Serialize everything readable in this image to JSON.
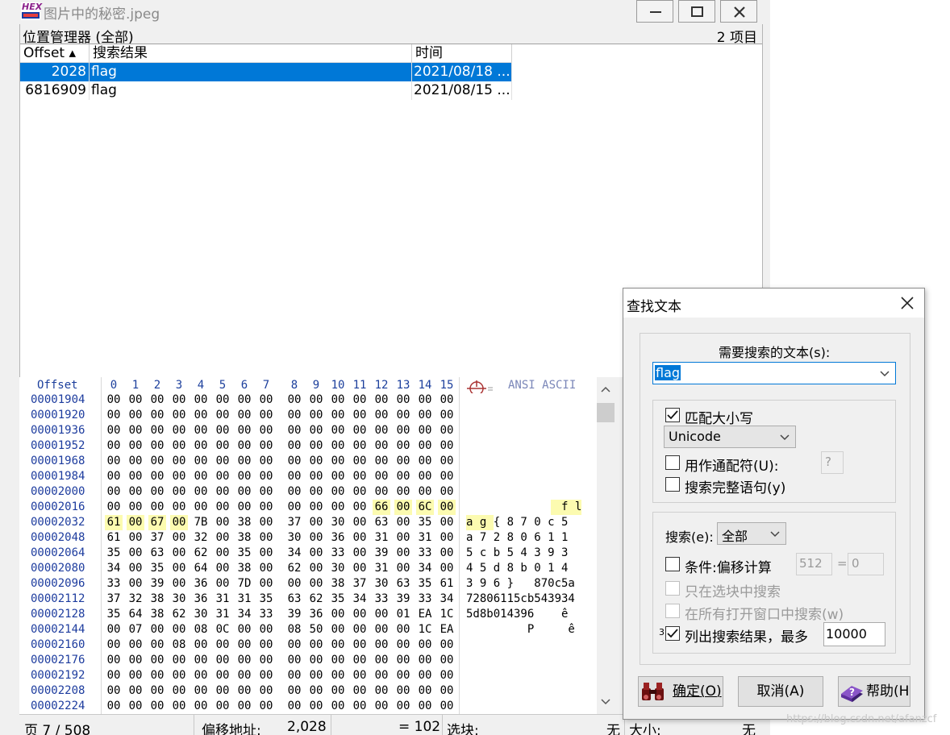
{
  "window": {
    "title": "图片中的秘密.jpeg",
    "logo_text": "HEX"
  },
  "position_manager": {
    "title": "位置管理器 (全部)",
    "count": "2 项目",
    "columns": [
      "Offset ▴",
      "搜索结果",
      "时间"
    ],
    "rows": [
      {
        "offset": "2028",
        "result": "flag",
        "time": "2021/08/18 ...",
        "selected": true
      },
      {
        "offset": "6816909",
        "result": "flag",
        "time": "2021/08/15 ...",
        "selected": false
      }
    ]
  },
  "hex_editor": {
    "offset_header": "Offset",
    "columns": [
      "0",
      "1",
      "2",
      "3",
      "4",
      "5",
      "6",
      "7",
      "8",
      "9",
      "10",
      "11",
      "12",
      "13",
      "14",
      "15"
    ],
    "ansi_header": "ANSI ASCII",
    "rows": [
      {
        "offset": "00001904",
        "bytes": [
          "00",
          "00",
          "00",
          "00",
          "00",
          "00",
          "00",
          "00",
          "00",
          "00",
          "00",
          "00",
          "00",
          "00",
          "00",
          "00"
        ],
        "ascii": ""
      },
      {
        "offset": "00001920",
        "bytes": [
          "00",
          "00",
          "00",
          "00",
          "00",
          "00",
          "00",
          "00",
          "00",
          "00",
          "00",
          "00",
          "00",
          "00",
          "00",
          "00"
        ],
        "ascii": ""
      },
      {
        "offset": "00001936",
        "bytes": [
          "00",
          "00",
          "00",
          "00",
          "00",
          "00",
          "00",
          "00",
          "00",
          "00",
          "00",
          "00",
          "00",
          "00",
          "00",
          "00"
        ],
        "ascii": ""
      },
      {
        "offset": "00001952",
        "bytes": [
          "00",
          "00",
          "00",
          "00",
          "00",
          "00",
          "00",
          "00",
          "00",
          "00",
          "00",
          "00",
          "00",
          "00",
          "00",
          "00"
        ],
        "ascii": ""
      },
      {
        "offset": "00001968",
        "bytes": [
          "00",
          "00",
          "00",
          "00",
          "00",
          "00",
          "00",
          "00",
          "00",
          "00",
          "00",
          "00",
          "00",
          "00",
          "00",
          "00"
        ],
        "ascii": ""
      },
      {
        "offset": "00001984",
        "bytes": [
          "00",
          "00",
          "00",
          "00",
          "00",
          "00",
          "00",
          "00",
          "00",
          "00",
          "00",
          "00",
          "00",
          "00",
          "00",
          "00"
        ],
        "ascii": ""
      },
      {
        "offset": "00002000",
        "bytes": [
          "00",
          "00",
          "00",
          "00",
          "00",
          "00",
          "00",
          "00",
          "00",
          "00",
          "00",
          "00",
          "00",
          "00",
          "00",
          "00"
        ],
        "ascii": ""
      },
      {
        "offset": "00002016",
        "bytes": [
          "00",
          "00",
          "00",
          "00",
          "00",
          "00",
          "00",
          "00",
          "00",
          "00",
          "00",
          "00",
          "66",
          "00",
          "6C",
          "00"
        ],
        "ascii": "              f l"
      },
      {
        "offset": "00002032",
        "bytes": [
          "61",
          "00",
          "67",
          "00",
          "7B",
          "00",
          "38",
          "00",
          "37",
          "00",
          "30",
          "00",
          "63",
          "00",
          "35",
          "00"
        ],
        "ascii": "a g { 8 7 0 c 5 "
      },
      {
        "offset": "00002048",
        "bytes": [
          "61",
          "00",
          "37",
          "00",
          "32",
          "00",
          "38",
          "00",
          "30",
          "00",
          "36",
          "00",
          "31",
          "00",
          "31",
          "00"
        ],
        "ascii": "a 7 2 8 0 6 1 1 "
      },
      {
        "offset": "00002064",
        "bytes": [
          "35",
          "00",
          "63",
          "00",
          "62",
          "00",
          "35",
          "00",
          "34",
          "00",
          "33",
          "00",
          "39",
          "00",
          "33",
          "00"
        ],
        "ascii": "5 c b 5 4 3 9 3 "
      },
      {
        "offset": "00002080",
        "bytes": [
          "34",
          "00",
          "35",
          "00",
          "64",
          "00",
          "38",
          "00",
          "62",
          "00",
          "30",
          "00",
          "31",
          "00",
          "34",
          "00"
        ],
        "ascii": "4 5 d 8 b 0 1 4 "
      },
      {
        "offset": "00002096",
        "bytes": [
          "33",
          "00",
          "39",
          "00",
          "36",
          "00",
          "7D",
          "00",
          "00",
          "00",
          "38",
          "37",
          "30",
          "63",
          "35",
          "61"
        ],
        "ascii": "3 9 6 }   870c5a"
      },
      {
        "offset": "00002112",
        "bytes": [
          "37",
          "32",
          "38",
          "30",
          "36",
          "31",
          "31",
          "35",
          "63",
          "62",
          "35",
          "34",
          "33",
          "39",
          "33",
          "34"
        ],
        "ascii": "72806115cb543934"
      },
      {
        "offset": "00002128",
        "bytes": [
          "35",
          "64",
          "38",
          "62",
          "30",
          "31",
          "34",
          "33",
          "39",
          "36",
          "00",
          "00",
          "00",
          "01",
          "EA",
          "1C"
        ],
        "ascii": "5d8b014396    ê "
      },
      {
        "offset": "00002144",
        "bytes": [
          "00",
          "07",
          "00",
          "00",
          "08",
          "0C",
          "00",
          "00",
          "08",
          "50",
          "00",
          "00",
          "00",
          "00",
          "1C",
          "EA"
        ],
        "ascii": "         P     ê"
      },
      {
        "offset": "00002160",
        "bytes": [
          "00",
          "00",
          "00",
          "08",
          "00",
          "00",
          "00",
          "00",
          "00",
          "00",
          "00",
          "00",
          "00",
          "00",
          "00",
          "00"
        ],
        "ascii": ""
      },
      {
        "offset": "00002176",
        "bytes": [
          "00",
          "00",
          "00",
          "00",
          "00",
          "00",
          "00",
          "00",
          "00",
          "00",
          "00",
          "00",
          "00",
          "00",
          "00",
          "00"
        ],
        "ascii": ""
      },
      {
        "offset": "00002192",
        "bytes": [
          "00",
          "00",
          "00",
          "00",
          "00",
          "00",
          "00",
          "00",
          "00",
          "00",
          "00",
          "00",
          "00",
          "00",
          "00",
          "00"
        ],
        "ascii": ""
      },
      {
        "offset": "00002208",
        "bytes": [
          "00",
          "00",
          "00",
          "00",
          "00",
          "00",
          "00",
          "00",
          "00",
          "00",
          "00",
          "00",
          "00",
          "00",
          "00",
          "00"
        ],
        "ascii": ""
      },
      {
        "offset": "00002224",
        "bytes": [
          "00",
          "00",
          "00",
          "00",
          "00",
          "00",
          "00",
          "00",
          "00",
          "00",
          "00",
          "00",
          "00",
          "00",
          "00",
          "00"
        ],
        "ascii": ""
      }
    ],
    "highlight_color": "#fcfbb0",
    "offset_color": "#1d3c9e"
  },
  "statusbar": {
    "page": "页 7 / 508",
    "offset_label": "偏移地址:",
    "offset_value": "2,028",
    "value": "= 102",
    "block_label": "选块:",
    "block_value": "无",
    "size_label": "大小:",
    "size_value": "无"
  },
  "find_dialog": {
    "title": "查找文本",
    "search_label": "需要搜索的文本(s):",
    "search_value": "flag",
    "match_case": {
      "label": "匹配大小写",
      "checked": true
    },
    "encoding": "Unicode",
    "wildcard": {
      "label": "用作通配符(U):",
      "checked": false,
      "value": "?"
    },
    "whole_word": {
      "label": "搜索完整语句(y)",
      "checked": false
    },
    "search_scope_label": "搜索(e):",
    "search_scope_value": "全部",
    "condition": {
      "label": "条件:偏移计算",
      "checked": false,
      "value1": "512",
      "eq": "=",
      "value2": "0"
    },
    "in_block": {
      "label": "只在选块中搜索",
      "checked": false
    },
    "all_windows": {
      "label": "在所有打开窗口中搜索(w)",
      "checked": false
    },
    "list_results": {
      "prefix": "3",
      "label": "列出搜索结果，最多",
      "checked": true,
      "value": "10000"
    },
    "ok_label": "确定(O)",
    "cancel_label": "取消(A)",
    "help_label": "帮助(H"
  },
  "watermark": "https://blog.csdn.net/afanzcf",
  "colors": {
    "selection": "#0078d7",
    "accent": "#1c3f9c"
  }
}
